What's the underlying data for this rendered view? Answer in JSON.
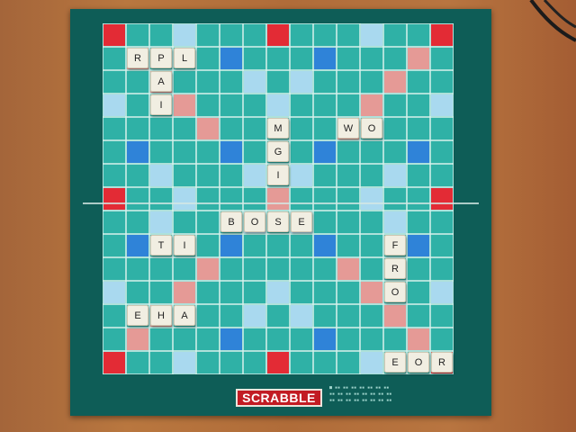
{
  "brand": "SCRABBLE",
  "colors": {
    "board": "#0e5d57",
    "grid": "#2fb1a6",
    "line": "#d9f1ec",
    "triple_word": "#e32b35",
    "double_word": "#e59a96",
    "triple_letter": "#2f83d8",
    "double_letter": "#a9d9ef",
    "tile": "#f1eee2",
    "table": "#b06c39"
  },
  "premium_squares": {
    "TW": [
      [
        0,
        0
      ],
      [
        0,
        7
      ],
      [
        0,
        14
      ],
      [
        7,
        0
      ],
      [
        7,
        14
      ],
      [
        14,
        0
      ],
      [
        14,
        7
      ],
      [
        14,
        14
      ]
    ],
    "DW": [
      [
        1,
        1
      ],
      [
        2,
        2
      ],
      [
        3,
        3
      ],
      [
        4,
        4
      ],
      [
        1,
        13
      ],
      [
        2,
        12
      ],
      [
        3,
        11
      ],
      [
        4,
        10
      ],
      [
        13,
        1
      ],
      [
        12,
        2
      ],
      [
        11,
        3
      ],
      [
        10,
        4
      ],
      [
        13,
        13
      ],
      [
        12,
        12
      ],
      [
        11,
        11
      ],
      [
        10,
        10
      ],
      [
        7,
        7
      ]
    ],
    "TL": [
      [
        1,
        5
      ],
      [
        1,
        9
      ],
      [
        5,
        1
      ],
      [
        5,
        5
      ],
      [
        5,
        9
      ],
      [
        5,
        13
      ],
      [
        9,
        1
      ],
      [
        9,
        5
      ],
      [
        9,
        9
      ],
      [
        9,
        13
      ],
      [
        13,
        5
      ],
      [
        13,
        9
      ]
    ],
    "DL": [
      [
        0,
        3
      ],
      [
        0,
        11
      ],
      [
        2,
        6
      ],
      [
        2,
        8
      ],
      [
        3,
        0
      ],
      [
        3,
        7
      ],
      [
        3,
        14
      ],
      [
        6,
        2
      ],
      [
        6,
        6
      ],
      [
        6,
        8
      ],
      [
        6,
        12
      ],
      [
        7,
        3
      ],
      [
        7,
        11
      ],
      [
        8,
        2
      ],
      [
        8,
        6
      ],
      [
        8,
        8
      ],
      [
        8,
        12
      ],
      [
        11,
        0
      ],
      [
        11,
        7
      ],
      [
        11,
        14
      ],
      [
        12,
        6
      ],
      [
        12,
        8
      ],
      [
        14,
        3
      ],
      [
        14,
        11
      ]
    ]
  },
  "tiles": [
    {
      "letter": "R",
      "row": 1,
      "col": 1
    },
    {
      "letter": "P",
      "row": 1,
      "col": 2
    },
    {
      "letter": "L",
      "row": 1,
      "col": 3
    },
    {
      "letter": "A",
      "row": 2,
      "col": 2
    },
    {
      "letter": "I",
      "row": 3,
      "col": 2
    },
    {
      "letter": "M",
      "row": 4,
      "col": 7
    },
    {
      "letter": "G",
      "row": 5,
      "col": 7
    },
    {
      "letter": "I",
      "row": 6,
      "col": 7
    },
    {
      "letter": "W",
      "row": 4,
      "col": 10
    },
    {
      "letter": "O",
      "row": 4,
      "col": 11
    },
    {
      "letter": "B",
      "row": 8,
      "col": 5
    },
    {
      "letter": "O",
      "row": 8,
      "col": 6
    },
    {
      "letter": "S",
      "row": 8,
      "col": 7
    },
    {
      "letter": "E",
      "row": 8,
      "col": 8
    },
    {
      "letter": "T",
      "row": 9,
      "col": 2
    },
    {
      "letter": "I",
      "row": 9,
      "col": 3
    },
    {
      "letter": "F",
      "row": 9,
      "col": 12
    },
    {
      "letter": "R",
      "row": 10,
      "col": 12
    },
    {
      "letter": "O",
      "row": 11,
      "col": 12
    },
    {
      "letter": "E",
      "row": 12,
      "col": 1
    },
    {
      "letter": "H",
      "row": 12,
      "col": 2
    },
    {
      "letter": "A",
      "row": 12,
      "col": 3
    },
    {
      "letter": "E",
      "row": 14,
      "col": 12
    },
    {
      "letter": "O",
      "row": 14,
      "col": 13
    },
    {
      "letter": "R",
      "row": 14,
      "col": 14
    }
  ]
}
